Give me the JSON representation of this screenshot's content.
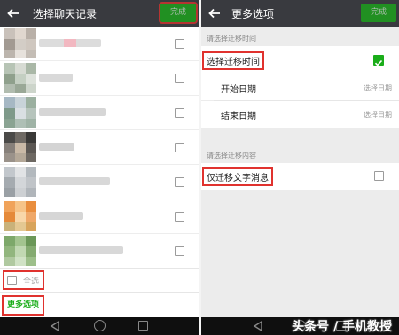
{
  "left": {
    "title": "选择聊天记录",
    "done_label": "完成",
    "chat_count": 7,
    "select_all_label": "全选",
    "more_options_label": "更多选项"
  },
  "right": {
    "title": "更多选项",
    "done_label": "完成",
    "section_time": "请选择迁移时间",
    "select_time_label": "选择迁移时间",
    "select_time_checked": true,
    "start_date_label": "开始日期",
    "start_date_value": "选择日期",
    "end_date_label": "结束日期",
    "end_date_value": "选择日期",
    "section_content": "请选择迁移内容",
    "text_only_label": "仅迁移文字消息",
    "text_only_checked": false
  },
  "watermark": "头条号 / 手机教授",
  "colors": {
    "topbar": "#393a3f",
    "accent": "#1aad19",
    "highlight": "#e0322e",
    "navbar": "#0f0f0f"
  }
}
